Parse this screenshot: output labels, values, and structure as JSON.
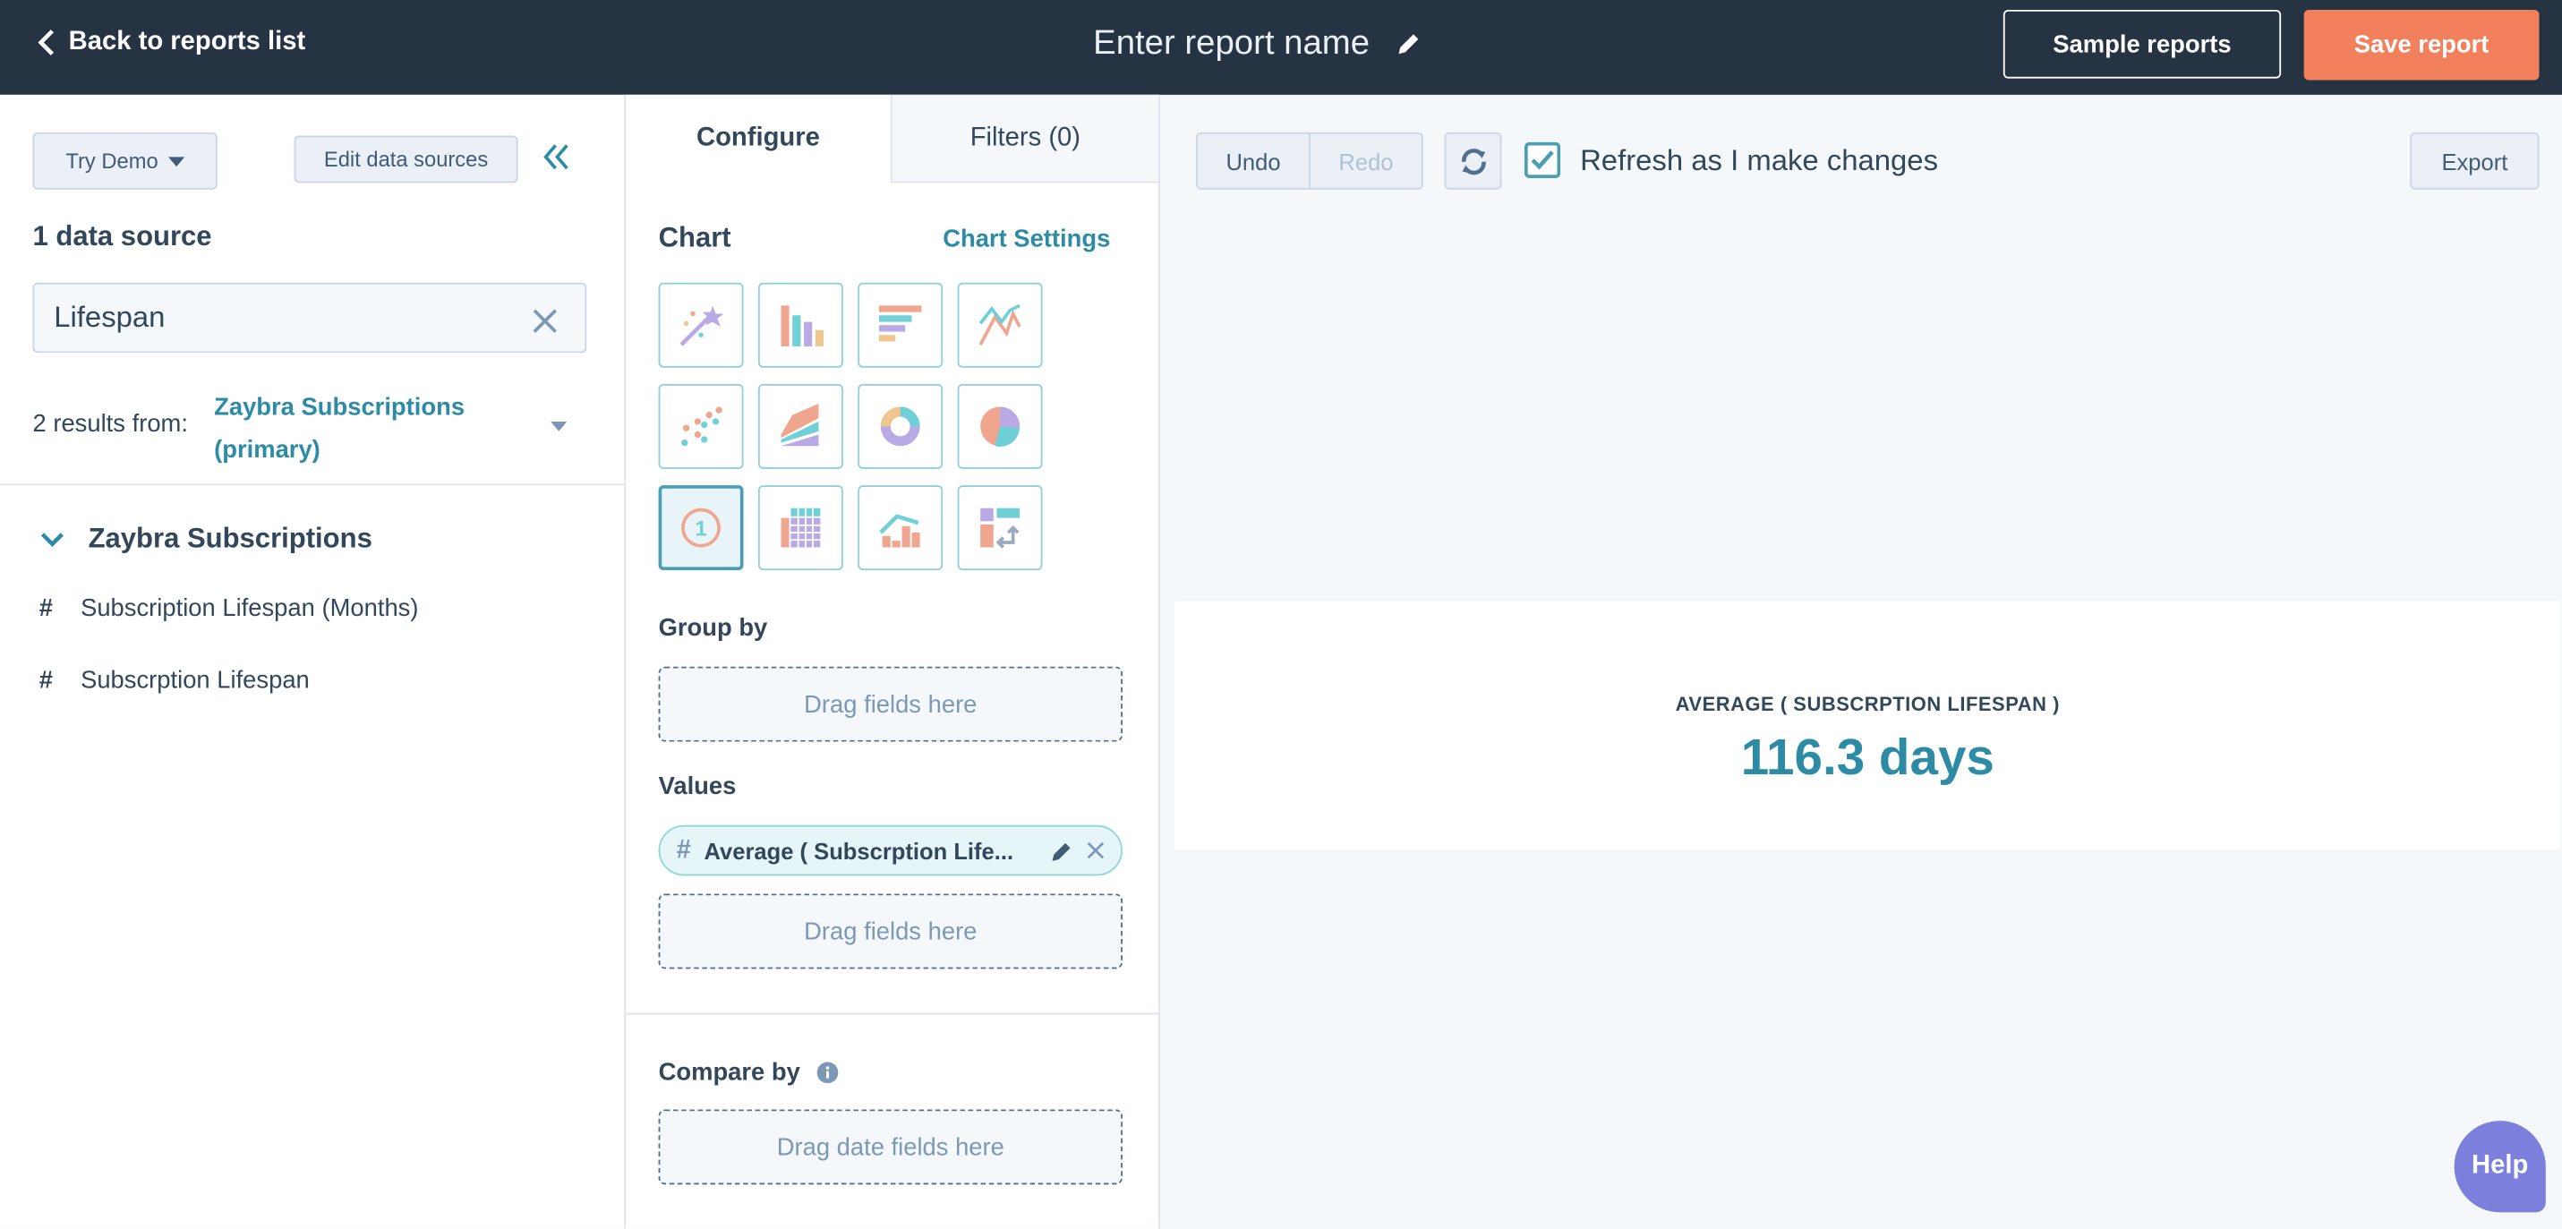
{
  "header": {
    "back_label": "Back to reports list",
    "report_name_placeholder": "Enter report name",
    "sample_reports": "Sample reports",
    "save_report": "Save report"
  },
  "left_panel": {
    "try_demo": "Try Demo",
    "edit_data_sources": "Edit data sources",
    "data_source_count": "1 data source",
    "search_value": "Lifespan",
    "results_prefix": "2 results from:",
    "results_source_line1": "Zaybra Subscriptions",
    "results_source_line2": "(primary)",
    "group_title": "Zaybra Subscriptions",
    "fields": [
      {
        "label": "Subscription Lifespan (Months)",
        "icon": "hash"
      },
      {
        "label": "Subscrption Lifespan",
        "icon": "hash"
      }
    ]
  },
  "config": {
    "tabs": [
      {
        "label": "Configure",
        "active": true
      },
      {
        "label": "Filters (0)",
        "active": false
      }
    ],
    "chart_label": "Chart",
    "chart_settings": "Chart Settings",
    "chart_types": [
      "magic-wand",
      "vertical-bar",
      "horizontal-bar",
      "line",
      "scatter",
      "area",
      "donut",
      "pie",
      "kpi",
      "pivot-table",
      "combo",
      "summary"
    ],
    "selected_chart_type": "kpi",
    "group_by": "Group by",
    "drag_fields": "Drag fields here",
    "values": "Values",
    "value_pill": "Average ( Subscrption Life...",
    "compare_by": "Compare by",
    "drag_date_fields": "Drag date fields here"
  },
  "toolbar": {
    "undo": "Undo",
    "redo": "Redo",
    "refresh_label": "Refresh as I make changes",
    "refresh_checked": true,
    "export": "Export"
  },
  "kpi": {
    "label": "AVERAGE ( SUBSCRPTION LIFESPAN )",
    "value": "116.3 days"
  },
  "help": "Help",
  "colors": {
    "header_bg": "#253342",
    "accent": "#2e8ba6",
    "save": "#f2805d",
    "help": "#7c7fdc"
  }
}
